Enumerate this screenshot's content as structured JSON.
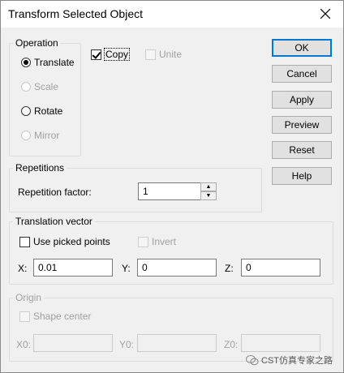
{
  "window": {
    "title": "Transform Selected Object",
    "close_icon": "close-icon"
  },
  "operation": {
    "legend": "Operation",
    "options": [
      {
        "label": "Translate",
        "checked": true,
        "enabled": true
      },
      {
        "label": "Scale",
        "checked": false,
        "enabled": false
      },
      {
        "label": "Rotate",
        "checked": false,
        "enabled": true
      },
      {
        "label": "Mirror",
        "checked": false,
        "enabled": false
      }
    ]
  },
  "copy": {
    "label": "Copy",
    "checked": true
  },
  "unite": {
    "label": "Unite",
    "checked": false,
    "enabled": false
  },
  "buttons": {
    "ok": "OK",
    "cancel": "Cancel",
    "apply": "Apply",
    "preview": "Preview",
    "reset": "Reset",
    "help": "Help"
  },
  "repetitions": {
    "legend": "Repetitions",
    "factor_label": "Repetition factor:",
    "factor_value": "1"
  },
  "translation": {
    "legend": "Translation vector",
    "use_picked_label": "Use picked points",
    "invert_label": "Invert",
    "x_label": "X:",
    "x_value": "0.01",
    "y_label": "Y:",
    "y_value": "0",
    "z_label": "Z:",
    "z_value": "0"
  },
  "origin": {
    "legend": "Origin",
    "shape_center_label": "Shape center",
    "x0_label": "X0:",
    "y0_label": "Y0:",
    "z0_label": "Z0:",
    "x0_value": "",
    "y0_value": "",
    "z0_value": ""
  },
  "watermark": "CST仿真专家之路"
}
